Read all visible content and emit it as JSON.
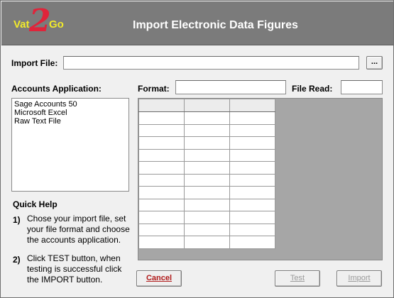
{
  "header": {
    "logo": {
      "part1": "Vat",
      "part2": "2",
      "part3": "Go"
    },
    "title": "Import Electronic Data Figures"
  },
  "import_file": {
    "label": "Import File:",
    "value": "",
    "browse_label": "..."
  },
  "accounts": {
    "label": "Accounts Application:",
    "options": [
      "Sage Accounts 50",
      "Microsoft Excel",
      "Raw Text File"
    ]
  },
  "format": {
    "label": "Format:",
    "value": ""
  },
  "file_read": {
    "label": "File Read:",
    "value": ""
  },
  "quick_help": {
    "title": "Quick Help",
    "steps": [
      {
        "num": "1)",
        "text": "Chose your import file, set your file format and choose the accounts application."
      },
      {
        "num": "2)",
        "text": "Click TEST button, when testing is successful click the IMPORT button."
      }
    ]
  },
  "buttons": {
    "cancel": "Cancel",
    "test": "Test",
    "import": "Import"
  },
  "colors": {
    "header_bg": "#7b7b7b",
    "logo_yellow": "#f2ea2b",
    "logo_red": "#e0243a",
    "cancel_text": "#b01a1a"
  }
}
